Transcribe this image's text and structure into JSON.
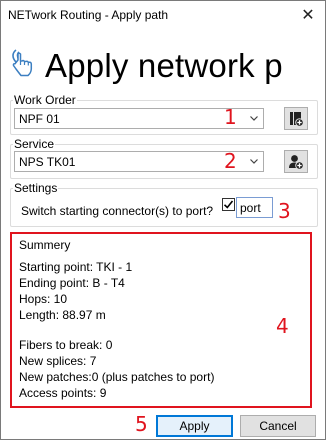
{
  "window": {
    "title": "NETwork Routing - Apply path",
    "close_glyph": "✕"
  },
  "header": {
    "icon": "touch-network-icon",
    "title": "Apply network p"
  },
  "work_order": {
    "label": "Work Order",
    "value": "NPF 01",
    "button_icon": "document-add-icon",
    "annotation": "1"
  },
  "service": {
    "label": "Service",
    "value": "NPS TK01",
    "button_icon": "user-add-icon",
    "annotation": "2"
  },
  "settings": {
    "label": "Settings",
    "switch_label": "Switch starting connector(s) to port?",
    "checked": true,
    "port_value": "port",
    "annotation": "3"
  },
  "summary": {
    "label": "Summery",
    "annotation": "4",
    "lines_a": [
      "Starting point: TKI - 1",
      "Ending point: B - T4",
      "Hops: 10",
      "Length: 88.97 m"
    ],
    "lines_b": [
      "Fibers to break: 0",
      "New splices: 7",
      "New patches:0 (plus patches to port)",
      "Access points: 9"
    ]
  },
  "footer": {
    "annotation": "5",
    "apply_label": "Apply",
    "cancel_label": "Cancel"
  },
  "colors": {
    "annotation_red": "#e0141e",
    "accent_blue": "#0078d7"
  }
}
